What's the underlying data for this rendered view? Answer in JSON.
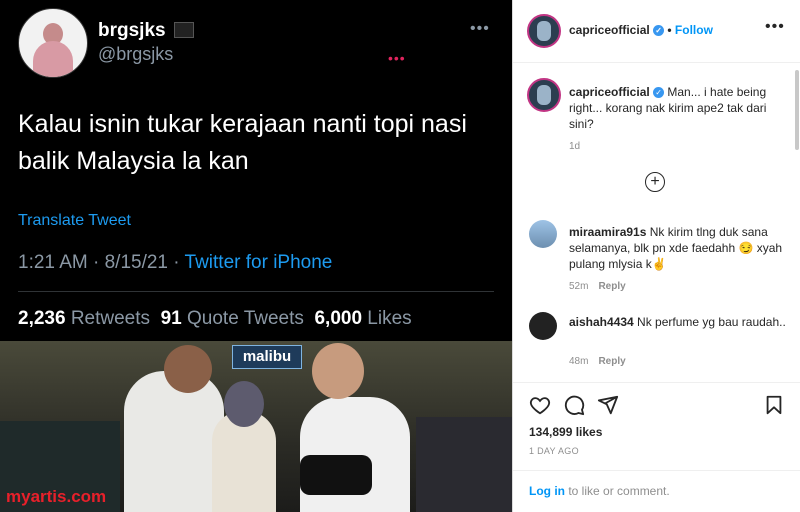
{
  "tweet": {
    "name": "brgsjks",
    "handle": "@brgsjks",
    "text": "Kalau isnin tukar kerajaan nanti topi nasi balik Malaysia la kan",
    "translate_label": "Translate Tweet",
    "time": "1:21 AM · 8/15/21 · ",
    "source": "Twitter for iPhone",
    "retweets_count": "2,236",
    "retweets_label": "Retweets",
    "quotes_count": "91",
    "quotes_label": "Quote Tweets",
    "likes_count": "6,000",
    "likes_label": "Likes",
    "photo_sign": "malibu",
    "more_glyph": "•••",
    "red_dots": "•••"
  },
  "watermark": "myartis.com",
  "instagram": {
    "account": "capriceofficial",
    "follow_sep": " • ",
    "follow_label": "Follow",
    "more_glyph": "•••",
    "caption": {
      "user": "capriceofficial",
      "text": " Man... i hate being right... korang nak kirim ape2 tak dari sini?",
      "time": "1d"
    },
    "comments": [
      {
        "user": "miraamira91s",
        "text": " Nk kirim tlng duk sana selamanya, blk pn xde faedahh 😏 xyah pulang mlysia k✌",
        "time": "52m",
        "reply": "Reply"
      },
      {
        "user": "aishah4434",
        "text": " Nk perfume yg bau raudah..",
        "time": "48m",
        "reply": "Reply"
      }
    ],
    "likes": "134,899 likes",
    "posted": "1 DAY AGO",
    "login_link": "Log in",
    "login_text": " to like or comment."
  },
  "icons": [
    "heart-icon",
    "comment-icon",
    "share-icon",
    "bookmark-icon",
    "add-icon",
    "verified-icon",
    "more-icon"
  ],
  "colors": {
    "twitter_bg": "#000000",
    "twitter_blue": "#1d9bf0",
    "ig_blue": "#0095f6",
    "watermark_red": "#e8202a"
  }
}
